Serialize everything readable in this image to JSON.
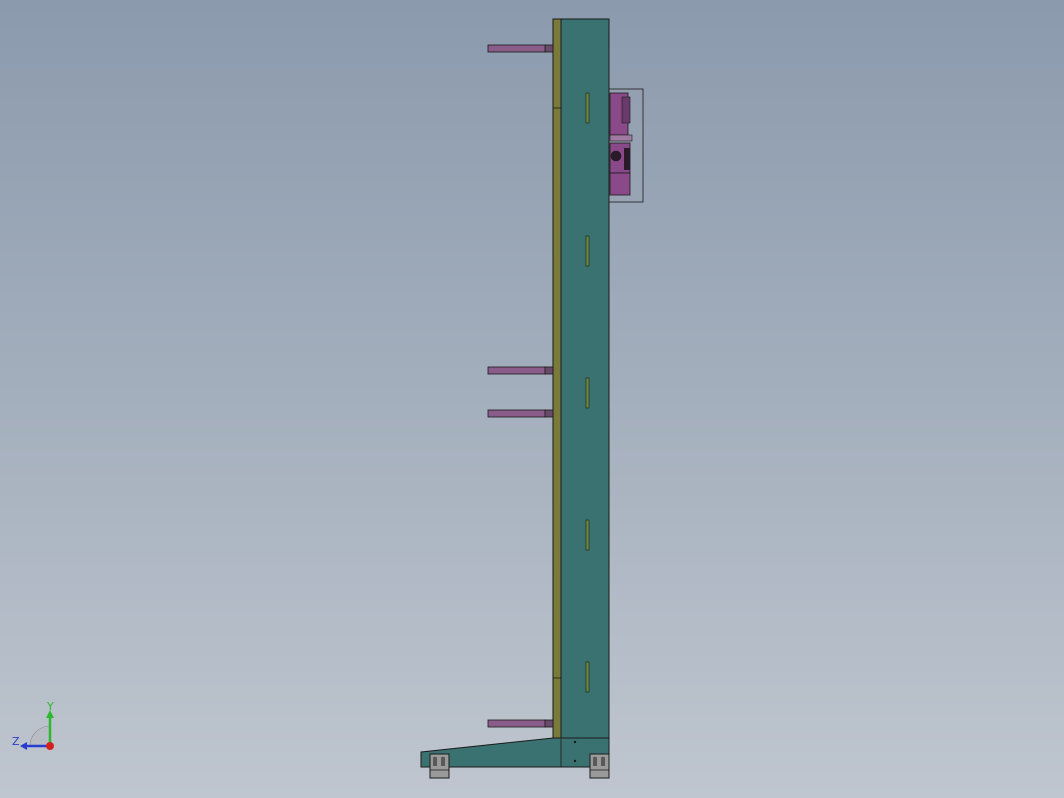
{
  "viewport": {
    "background_top": "#8b9aad",
    "background_bottom": "#bfc6cf"
  },
  "model": {
    "frame_color": "#3a7272",
    "rail_color": "#7a7a3a",
    "arm_color": "#8a5c8a",
    "slot_color": "#6a8a3a",
    "foot_color": "#9a9a9a",
    "motor_color": "#8a4a8a",
    "edge_color": "#1a1a1a"
  },
  "triad": {
    "y_label": "Y",
    "z_label": "Z",
    "y_color": "#2db82d",
    "z_color": "#2a3ccf",
    "x_color": "#d62020"
  }
}
